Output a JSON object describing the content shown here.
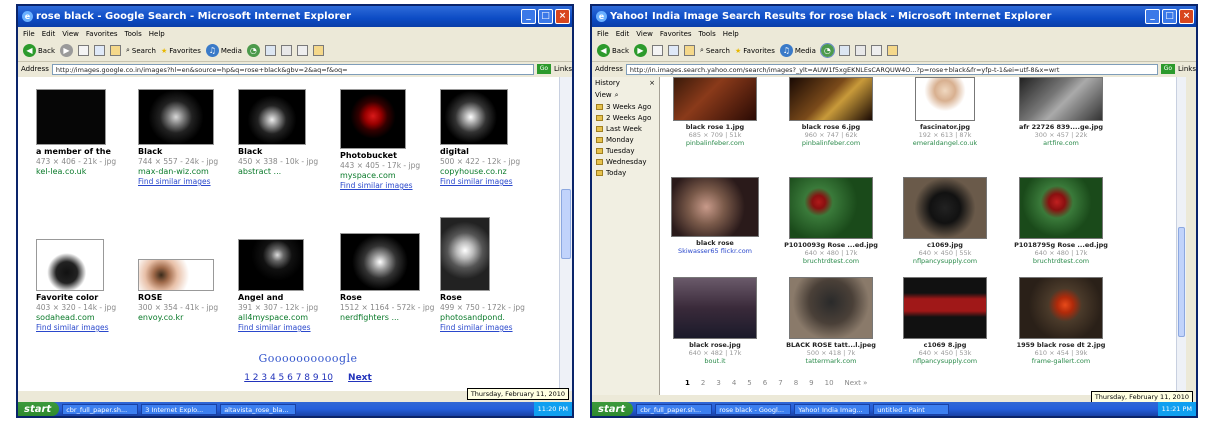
{
  "left_window": {
    "title": "rose black - Google Search - Microsoft Internet Explorer",
    "menu": [
      "File",
      "Edit",
      "View",
      "Favorites",
      "Tools",
      "Help"
    ],
    "toolbar": {
      "back": "Back",
      "search": "Search",
      "favorites": "Favorites",
      "media": "Media"
    },
    "address_label": "Address",
    "address": "http://images.google.co.in/images?hl=en&source=hp&q=rose+black&gbv=2&aq=f&oq=",
    "go": "Go",
    "links": "Links",
    "results": [
      {
        "title": "a member of the",
        "meta": "473 × 406 - 21k - jpg",
        "url": "kel-lea.co.uk",
        "similar": ""
      },
      {
        "title": "Black",
        "meta": "744 × 557 - 24k - jpg",
        "url": "max-dan-wiz.com",
        "similar": "Find similar images"
      },
      {
        "title": "Black",
        "meta": "450 × 338 - 10k - jpg",
        "url": "abstract ...",
        "similar": ""
      },
      {
        "title": "Photobucket",
        "meta": "443 × 405 - 17k - jpg",
        "url": "myspace.com",
        "similar": "Find similar images"
      },
      {
        "title": "digital",
        "meta": "500 × 422 - 12k - jpg",
        "url": "copyhouse.co.nz",
        "similar": "Find similar images"
      },
      {
        "title": "Favorite color",
        "meta": "403 × 320 - 14k - jpg",
        "url": "sodahead.com",
        "similar": "Find similar images"
      },
      {
        "title": "ROSE",
        "meta": "300 × 354 - 41k - jpg",
        "url": "envoy.co.kr",
        "similar": ""
      },
      {
        "title": "Angel and",
        "meta": "391 × 307 - 12k - jpg",
        "url": "all4myspace.com",
        "similar": "Find similar images"
      },
      {
        "title": "Rose",
        "meta": "1512 × 1164 - 572k - jpg",
        "url": "nerdfighters ...",
        "similar": ""
      },
      {
        "title": "Rose",
        "meta": "499 × 750 - 172k - jpg",
        "url": "photosandpond.",
        "similar": "Find similar images"
      }
    ],
    "pager_logo": "Goooooooooogle",
    "pages": "1 2 3 4 5 6 7 8 9 10",
    "next": "Next",
    "date": "Thursday, February 11, 2010",
    "taskbar": {
      "start": "start",
      "buttons": [
        "cbr_full_paper.sh...",
        "3 Internet Explo...",
        "altavista_rose_bla..."
      ],
      "time": "11:20 PM"
    }
  },
  "right_window": {
    "title": "Yahoo! India Image Search Results for rose black - Microsoft Internet Explorer",
    "menu": [
      "File",
      "Edit",
      "View",
      "Favorites",
      "Tools",
      "Help"
    ],
    "toolbar": {
      "back": "Back",
      "search": "Search",
      "favorites": "Favorites",
      "media": "Media"
    },
    "address_label": "Address",
    "address": "http://in.images.search.yahoo.com/search/images?_ylt=AUW1f5xgEKNLEsCARQUW4O...?p=rose+black&fr=yfp-t-1&ei=utf-8&x=wrt",
    "go": "Go",
    "links": "Links",
    "history": {
      "header": "History",
      "view": "View",
      "items": [
        "3 Weeks Ago",
        "2 Weeks Ago",
        "Last Week",
        "Monday",
        "Tuesday",
        "Wednesday",
        "Today"
      ]
    },
    "results": [
      {
        "title": "black rose 1.jpg",
        "meta": "685 × 709 | 51k",
        "url": "pinbalinfeber.com"
      },
      {
        "title": "black rose 6.jpg",
        "meta": "960 × 747 | 62k",
        "url": "pinbalinfeber.com"
      },
      {
        "title": "fascinator.jpg",
        "meta": "192 × 613 | 87k",
        "url": "emeraldangel.co.uk"
      },
      {
        "title": "afr 22726 839....ge.jpg",
        "meta": "300 × 457 | 22k",
        "url": "artfire.com"
      },
      {
        "title": "black rose",
        "meta": "",
        "url": "Skiwasser65 flickr.com"
      },
      {
        "title": "P1010093g Rose ...ed.jpg",
        "meta": "640 × 480 | 17k",
        "url": "bruchtrdtest.com"
      },
      {
        "title": "c1069.jpg",
        "meta": "640 × 450 | 55k",
        "url": "nflpancysupply.com"
      },
      {
        "title": "P1018795g Rose ...ed.jpg",
        "meta": "640 × 480 | 17k",
        "url": "bruchtrdtest.com"
      },
      {
        "title": "black rose.jpg",
        "meta": "640 × 482 | 17k",
        "url": "bout.it"
      },
      {
        "title": "BLACK ROSE tatt...l.jpeg",
        "meta": "500 × 418 | 7k",
        "url": "tattermark.com"
      },
      {
        "title": "c1069 8.jpg",
        "meta": "640 × 450 | 53k",
        "url": "nflpancysupply.com"
      },
      {
        "title": "1959 black rose dt 2.jpg",
        "meta": "610 × 454 | 39k",
        "url": "frame-gallert.com"
      }
    ],
    "pages": [
      "1",
      "2",
      "3",
      "4",
      "5",
      "6",
      "7",
      "8",
      "9",
      "10",
      "Next »"
    ],
    "date": "Thursday, February 11, 2010",
    "taskbar": {
      "start": "start",
      "buttons": [
        "cbr_full_paper.sh...",
        "rose black - Googl...",
        "Yahoo! India Imag...",
        "untitled - Paint"
      ],
      "time": "11:21 PM"
    }
  }
}
